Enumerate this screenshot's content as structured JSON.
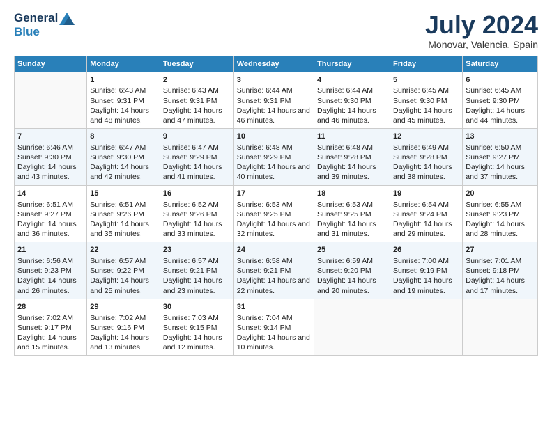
{
  "logo": {
    "line1": "General",
    "line2": "Blue"
  },
  "title": "July 2024",
  "subtitle": "Monovar, Valencia, Spain",
  "headers": [
    "Sunday",
    "Monday",
    "Tuesday",
    "Wednesday",
    "Thursday",
    "Friday",
    "Saturday"
  ],
  "weeks": [
    [
      {
        "day": "",
        "sunrise": "",
        "sunset": "",
        "daylight": ""
      },
      {
        "day": "1",
        "sunrise": "Sunrise: 6:43 AM",
        "sunset": "Sunset: 9:31 PM",
        "daylight": "Daylight: 14 hours and 48 minutes."
      },
      {
        "day": "2",
        "sunrise": "Sunrise: 6:43 AM",
        "sunset": "Sunset: 9:31 PM",
        "daylight": "Daylight: 14 hours and 47 minutes."
      },
      {
        "day": "3",
        "sunrise": "Sunrise: 6:44 AM",
        "sunset": "Sunset: 9:31 PM",
        "daylight": "Daylight: 14 hours and 46 minutes."
      },
      {
        "day": "4",
        "sunrise": "Sunrise: 6:44 AM",
        "sunset": "Sunset: 9:30 PM",
        "daylight": "Daylight: 14 hours and 46 minutes."
      },
      {
        "day": "5",
        "sunrise": "Sunrise: 6:45 AM",
        "sunset": "Sunset: 9:30 PM",
        "daylight": "Daylight: 14 hours and 45 minutes."
      },
      {
        "day": "6",
        "sunrise": "Sunrise: 6:45 AM",
        "sunset": "Sunset: 9:30 PM",
        "daylight": "Daylight: 14 hours and 44 minutes."
      }
    ],
    [
      {
        "day": "7",
        "sunrise": "Sunrise: 6:46 AM",
        "sunset": "Sunset: 9:30 PM",
        "daylight": "Daylight: 14 hours and 43 minutes."
      },
      {
        "day": "8",
        "sunrise": "Sunrise: 6:47 AM",
        "sunset": "Sunset: 9:30 PM",
        "daylight": "Daylight: 14 hours and 42 minutes."
      },
      {
        "day": "9",
        "sunrise": "Sunrise: 6:47 AM",
        "sunset": "Sunset: 9:29 PM",
        "daylight": "Daylight: 14 hours and 41 minutes."
      },
      {
        "day": "10",
        "sunrise": "Sunrise: 6:48 AM",
        "sunset": "Sunset: 9:29 PM",
        "daylight": "Daylight: 14 hours and 40 minutes."
      },
      {
        "day": "11",
        "sunrise": "Sunrise: 6:48 AM",
        "sunset": "Sunset: 9:28 PM",
        "daylight": "Daylight: 14 hours and 39 minutes."
      },
      {
        "day": "12",
        "sunrise": "Sunrise: 6:49 AM",
        "sunset": "Sunset: 9:28 PM",
        "daylight": "Daylight: 14 hours and 38 minutes."
      },
      {
        "day": "13",
        "sunrise": "Sunrise: 6:50 AM",
        "sunset": "Sunset: 9:27 PM",
        "daylight": "Daylight: 14 hours and 37 minutes."
      }
    ],
    [
      {
        "day": "14",
        "sunrise": "Sunrise: 6:51 AM",
        "sunset": "Sunset: 9:27 PM",
        "daylight": "Daylight: 14 hours and 36 minutes."
      },
      {
        "day": "15",
        "sunrise": "Sunrise: 6:51 AM",
        "sunset": "Sunset: 9:26 PM",
        "daylight": "Daylight: 14 hours and 35 minutes."
      },
      {
        "day": "16",
        "sunrise": "Sunrise: 6:52 AM",
        "sunset": "Sunset: 9:26 PM",
        "daylight": "Daylight: 14 hours and 33 minutes."
      },
      {
        "day": "17",
        "sunrise": "Sunrise: 6:53 AM",
        "sunset": "Sunset: 9:25 PM",
        "daylight": "Daylight: 14 hours and 32 minutes."
      },
      {
        "day": "18",
        "sunrise": "Sunrise: 6:53 AM",
        "sunset": "Sunset: 9:25 PM",
        "daylight": "Daylight: 14 hours and 31 minutes."
      },
      {
        "day": "19",
        "sunrise": "Sunrise: 6:54 AM",
        "sunset": "Sunset: 9:24 PM",
        "daylight": "Daylight: 14 hours and 29 minutes."
      },
      {
        "day": "20",
        "sunrise": "Sunrise: 6:55 AM",
        "sunset": "Sunset: 9:23 PM",
        "daylight": "Daylight: 14 hours and 28 minutes."
      }
    ],
    [
      {
        "day": "21",
        "sunrise": "Sunrise: 6:56 AM",
        "sunset": "Sunset: 9:23 PM",
        "daylight": "Daylight: 14 hours and 26 minutes."
      },
      {
        "day": "22",
        "sunrise": "Sunrise: 6:57 AM",
        "sunset": "Sunset: 9:22 PM",
        "daylight": "Daylight: 14 hours and 25 minutes."
      },
      {
        "day": "23",
        "sunrise": "Sunrise: 6:57 AM",
        "sunset": "Sunset: 9:21 PM",
        "daylight": "Daylight: 14 hours and 23 minutes."
      },
      {
        "day": "24",
        "sunrise": "Sunrise: 6:58 AM",
        "sunset": "Sunset: 9:21 PM",
        "daylight": "Daylight: 14 hours and 22 minutes."
      },
      {
        "day": "25",
        "sunrise": "Sunrise: 6:59 AM",
        "sunset": "Sunset: 9:20 PM",
        "daylight": "Daylight: 14 hours and 20 minutes."
      },
      {
        "day": "26",
        "sunrise": "Sunrise: 7:00 AM",
        "sunset": "Sunset: 9:19 PM",
        "daylight": "Daylight: 14 hours and 19 minutes."
      },
      {
        "day": "27",
        "sunrise": "Sunrise: 7:01 AM",
        "sunset": "Sunset: 9:18 PM",
        "daylight": "Daylight: 14 hours and 17 minutes."
      }
    ],
    [
      {
        "day": "28",
        "sunrise": "Sunrise: 7:02 AM",
        "sunset": "Sunset: 9:17 PM",
        "daylight": "Daylight: 14 hours and 15 minutes."
      },
      {
        "day": "29",
        "sunrise": "Sunrise: 7:02 AM",
        "sunset": "Sunset: 9:16 PM",
        "daylight": "Daylight: 14 hours and 13 minutes."
      },
      {
        "day": "30",
        "sunrise": "Sunrise: 7:03 AM",
        "sunset": "Sunset: 9:15 PM",
        "daylight": "Daylight: 14 hours and 12 minutes."
      },
      {
        "day": "31",
        "sunrise": "Sunrise: 7:04 AM",
        "sunset": "Sunset: 9:14 PM",
        "daylight": "Daylight: 14 hours and 10 minutes."
      },
      {
        "day": "",
        "sunrise": "",
        "sunset": "",
        "daylight": ""
      },
      {
        "day": "",
        "sunrise": "",
        "sunset": "",
        "daylight": ""
      },
      {
        "day": "",
        "sunrise": "",
        "sunset": "",
        "daylight": ""
      }
    ]
  ]
}
